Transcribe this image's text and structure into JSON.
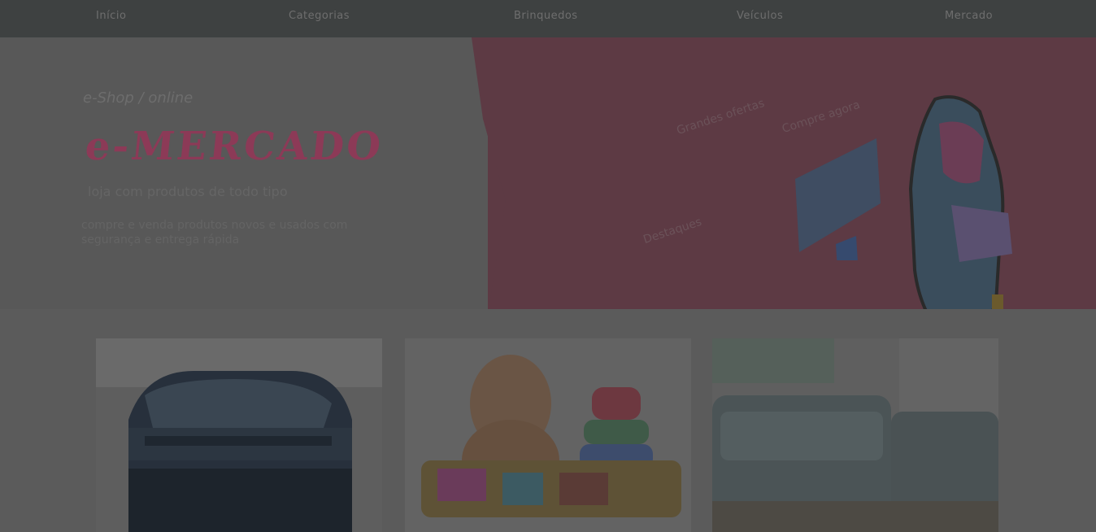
{
  "nav": {
    "items": [
      {
        "label": "Início"
      },
      {
        "label": "Categorias"
      },
      {
        "label": "Brinquedos"
      },
      {
        "label": "Veículos"
      },
      {
        "label": "Mercado"
      }
    ]
  },
  "hero": {
    "tagline": "e-Shop / online",
    "title": "e-MERCADO",
    "subtitle": "loja com produtos de todo tipo",
    "description": "compre e venda produtos novos e usados com segurança e entrega rápida",
    "phrases": [
      "Grandes ofertas",
      "Compre agora",
      "Destaques"
    ]
  },
  "cards": [
    {
      "name": "car"
    },
    {
      "name": "toys"
    },
    {
      "name": "sofa"
    }
  ],
  "colors": {
    "nav_bg": "#3e4141",
    "hero_red": "#5d3a44",
    "title": "#8c3a57"
  }
}
